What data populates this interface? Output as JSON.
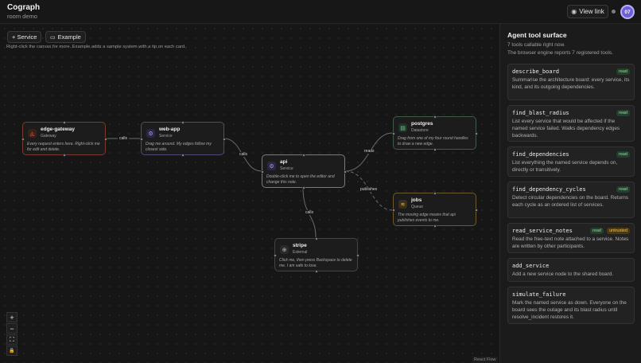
{
  "header": {
    "app_title": "Cograph",
    "room": "room demo",
    "view_link_label": "View link",
    "avatar_initials": "07"
  },
  "toolbar": {
    "add_service_label": "+ Service",
    "example_label": "Example",
    "hint": "Right-click the canvas for more. Example adds a sample system with a tip on each card."
  },
  "nodes": [
    {
      "id": "edge-gateway",
      "name": "edge-gateway",
      "kind": "Gateway",
      "note": "Every request enters here. Right-click me for edit and delete.",
      "icon": "gateway-icon",
      "accent": "#c0533f"
    },
    {
      "id": "web-app",
      "name": "web-app",
      "kind": "Service",
      "note": "Drag me around. My edges follow my closest side.",
      "icon": "service-icon",
      "accent": "#6f64b8"
    },
    {
      "id": "api",
      "name": "api",
      "kind": "Service",
      "note": "Double-click me to open the editor and change this note.",
      "icon": "service-icon",
      "accent": "#6f64b8"
    },
    {
      "id": "postgres",
      "name": "postgres",
      "kind": "Datastore",
      "note": "Drag from one of my four round handles to draw a new edge.",
      "icon": "datastore-icon",
      "accent": "#4fa36b"
    },
    {
      "id": "jobs",
      "name": "jobs",
      "kind": "Queue",
      "note": "The moving edge means that api publishes events to me.",
      "icon": "queue-icon",
      "accent": "#c9a13f"
    },
    {
      "id": "stripe",
      "name": "stripe",
      "kind": "External",
      "note": "Click me, then press Backspace to delete me. I am safe to lose.",
      "icon": "external-icon",
      "accent": "#8a8a8a"
    }
  ],
  "edges": [
    {
      "from": "edge-gateway",
      "to": "web-app",
      "label": "calls"
    },
    {
      "from": "web-app",
      "to": "api",
      "label": "calls"
    },
    {
      "from": "api",
      "to": "postgres",
      "label": "reads"
    },
    {
      "from": "api",
      "to": "jobs",
      "label": "publishes",
      "animated": true
    },
    {
      "from": "api",
      "to": "stripe",
      "label": "calls"
    }
  ],
  "controls": {
    "zoom_in": "+",
    "zoom_out": "−",
    "fit_view": "⛶",
    "lock": "🔒",
    "attribution": "React Flow"
  },
  "sidebar": {
    "title": "Agent tool surface",
    "line1": "7 tools callable right now.",
    "line2": "The browser engine reports 7 registered tools.",
    "tools": [
      {
        "name": "describe_board",
        "badges": [
          "read"
        ],
        "desc": "Summarise the architecture board: every service, its kind, and its outgoing dependencies."
      },
      {
        "name": "find_blast_radius",
        "badges": [
          "read"
        ],
        "desc": "List every service that would be affected if the named service failed. Walks dependency edges backwards."
      },
      {
        "name": "find_dependencies",
        "badges": [
          "read"
        ],
        "desc": "List everything the named service depends on, directly or transitively."
      },
      {
        "name": "find_dependency_cycles",
        "badges": [
          "read"
        ],
        "desc": "Detect circular dependencies on the board. Returns each cycle as an ordered list of services."
      },
      {
        "name": "read_service_notes",
        "badges": [
          "read",
          "untrusted"
        ],
        "desc": "Read the free-text note attached to a service. Notes are written by other participants."
      },
      {
        "name": "add_service",
        "badges": [],
        "desc": "Add a new service node to the shared board."
      },
      {
        "name": "simulate_failure",
        "badges": [],
        "desc": "Mark the named service as down. Everyone on the board sees the outage and its blast radius until resolve_incident restores it."
      }
    ]
  },
  "colors": {
    "accent": "#6d5fd8",
    "read_badge": "#9fd4a8",
    "untrusted_badge": "#f0c469"
  }
}
